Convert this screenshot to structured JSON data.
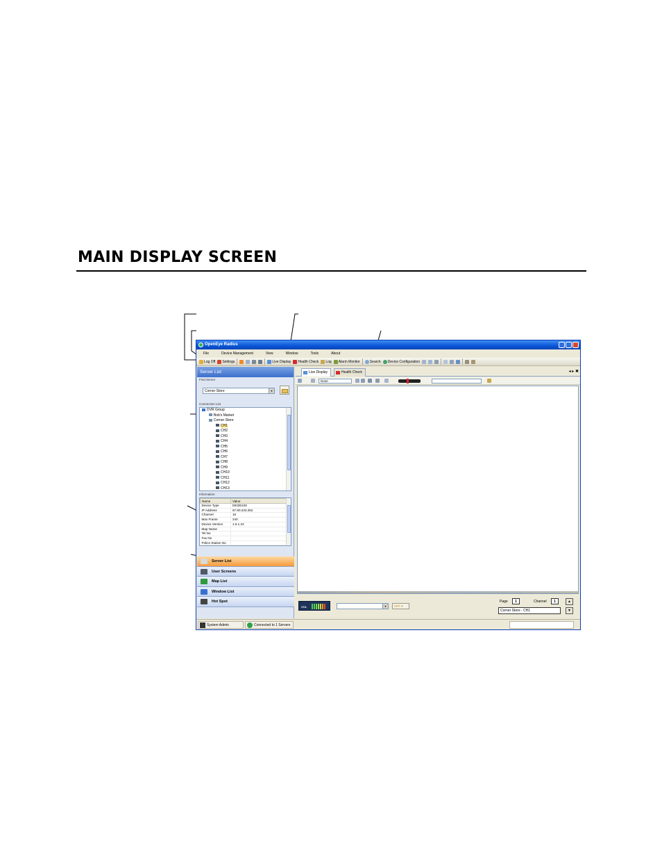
{
  "page": {
    "heading": "MAIN DISPLAY SCREEN"
  },
  "app": {
    "title": "OpenEye Radius",
    "menu": [
      "File",
      "Device Management",
      "View",
      "Window",
      "Tools",
      "About"
    ],
    "toolbar": {
      "log_off": "Log Off",
      "settings": "Settings",
      "live_display": "Live Display",
      "health_check": "Health Check",
      "log": "Log",
      "alarm_monitor": "Alarm Monitor",
      "search": "Search",
      "device_configuration": "Device Configuration"
    },
    "server_list": {
      "title": "Server List",
      "find_server_label": "Find Server",
      "find_server_value": "Corner Store",
      "connection_list_label": "Connection List",
      "tree": [
        {
          "label": "DVR Group",
          "level": 0,
          "icon": "group-icon"
        },
        {
          "label": "Bob's Market",
          "level": 1,
          "icon": "server-icon"
        },
        {
          "label": "Corner Store",
          "level": 1,
          "icon": "server-icon"
        },
        {
          "label": "CH1",
          "level": 2,
          "icon": "camera-icon",
          "selected": true
        },
        {
          "label": "CH2",
          "level": 2,
          "icon": "camera-icon"
        },
        {
          "label": "CH3",
          "level": 2,
          "icon": "camera-icon"
        },
        {
          "label": "CH4",
          "level": 2,
          "icon": "camera-icon"
        },
        {
          "label": "CH5",
          "level": 2,
          "icon": "camera-icon"
        },
        {
          "label": "CH6",
          "level": 2,
          "icon": "camera-icon"
        },
        {
          "label": "CH7",
          "level": 2,
          "icon": "camera-icon"
        },
        {
          "label": "CH8",
          "level": 2,
          "icon": "camera-icon"
        },
        {
          "label": "CH9",
          "level": 2,
          "icon": "camera-icon"
        },
        {
          "label": "CH10",
          "level": 2,
          "icon": "camera-icon"
        },
        {
          "label": "CH11",
          "level": 2,
          "icon": "camera-icon"
        },
        {
          "label": "CH12",
          "level": 2,
          "icon": "camera-icon"
        },
        {
          "label": "CH13",
          "level": 2,
          "icon": "camera-icon"
        }
      ],
      "information_label": "Information",
      "info_headers": [
        "Name",
        "Value"
      ],
      "info_rows": [
        [
          "Device Type",
          "DE3/E240"
        ],
        [
          "IP Address",
          "67.80.223.252"
        ],
        [
          "Channel",
          "16"
        ],
        [
          "Max Frame",
          "240"
        ],
        [
          "Device Version",
          "1.6.1.23"
        ],
        [
          "Map Name",
          ""
        ],
        [
          "Tel No",
          ""
        ],
        [
          "Fax No",
          ""
        ],
        [
          "Police Station No",
          ""
        ]
      ],
      "nav": [
        {
          "label": "Server List",
          "active": true,
          "color": "#d9d9d9"
        },
        {
          "label": "User Screens",
          "active": false,
          "color": "#505a66"
        },
        {
          "label": "Map List",
          "active": false,
          "color": "#2f9a3f"
        },
        {
          "label": "Window List",
          "active": false,
          "color": "#3a6fd0"
        },
        {
          "label": "Hot Spot",
          "active": false,
          "color": "#444444"
        }
      ]
    },
    "tabs": [
      "Live Display",
      "Health Check"
    ],
    "tab_controls": "◂ ▸ ✖",
    "control_bar": {
      "layout_value": "None"
    },
    "bottom": {
      "vol_label": "VOL",
      "off_label": "OFF",
      "page_label": "Page",
      "page_value": "1",
      "channel_label": "Channel",
      "channel_value": "1",
      "camera_value": "Corner Store - CH1"
    },
    "status": {
      "user": "System Admin",
      "connection": "Connected to 1 Servers"
    }
  }
}
